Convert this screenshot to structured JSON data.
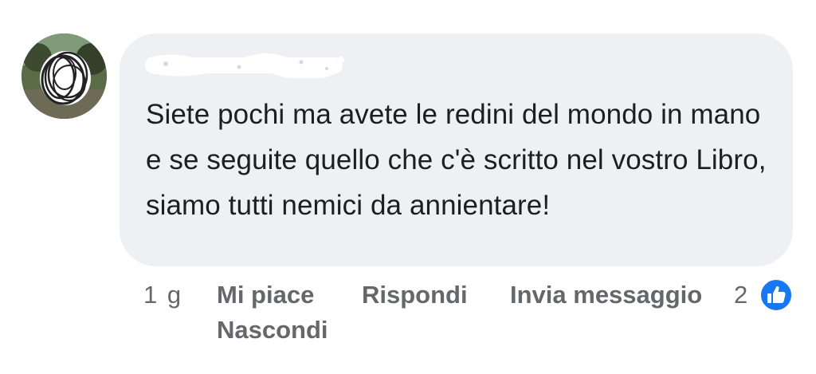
{
  "comment": {
    "author_name": "",
    "text": "Siete pochi ma avete le redini del mondo in mano e se seguite quello che c'è scritto nel vostro Libro, siamo tutti nemici da annientare!"
  },
  "actions": {
    "timestamp": "1 g",
    "like_label": "Mi piace",
    "reply_label": "Rispondi",
    "message_label": "Invia messaggio",
    "hide_label": "Nascondi",
    "reaction_count": "2"
  },
  "icons": {
    "reaction": "like-thumbs-up-icon"
  },
  "colors": {
    "bubble_background": "#eef0f3",
    "comment_text": "#1c1e21",
    "secondary_text": "#65676b",
    "like_blue": "#1877f2"
  }
}
